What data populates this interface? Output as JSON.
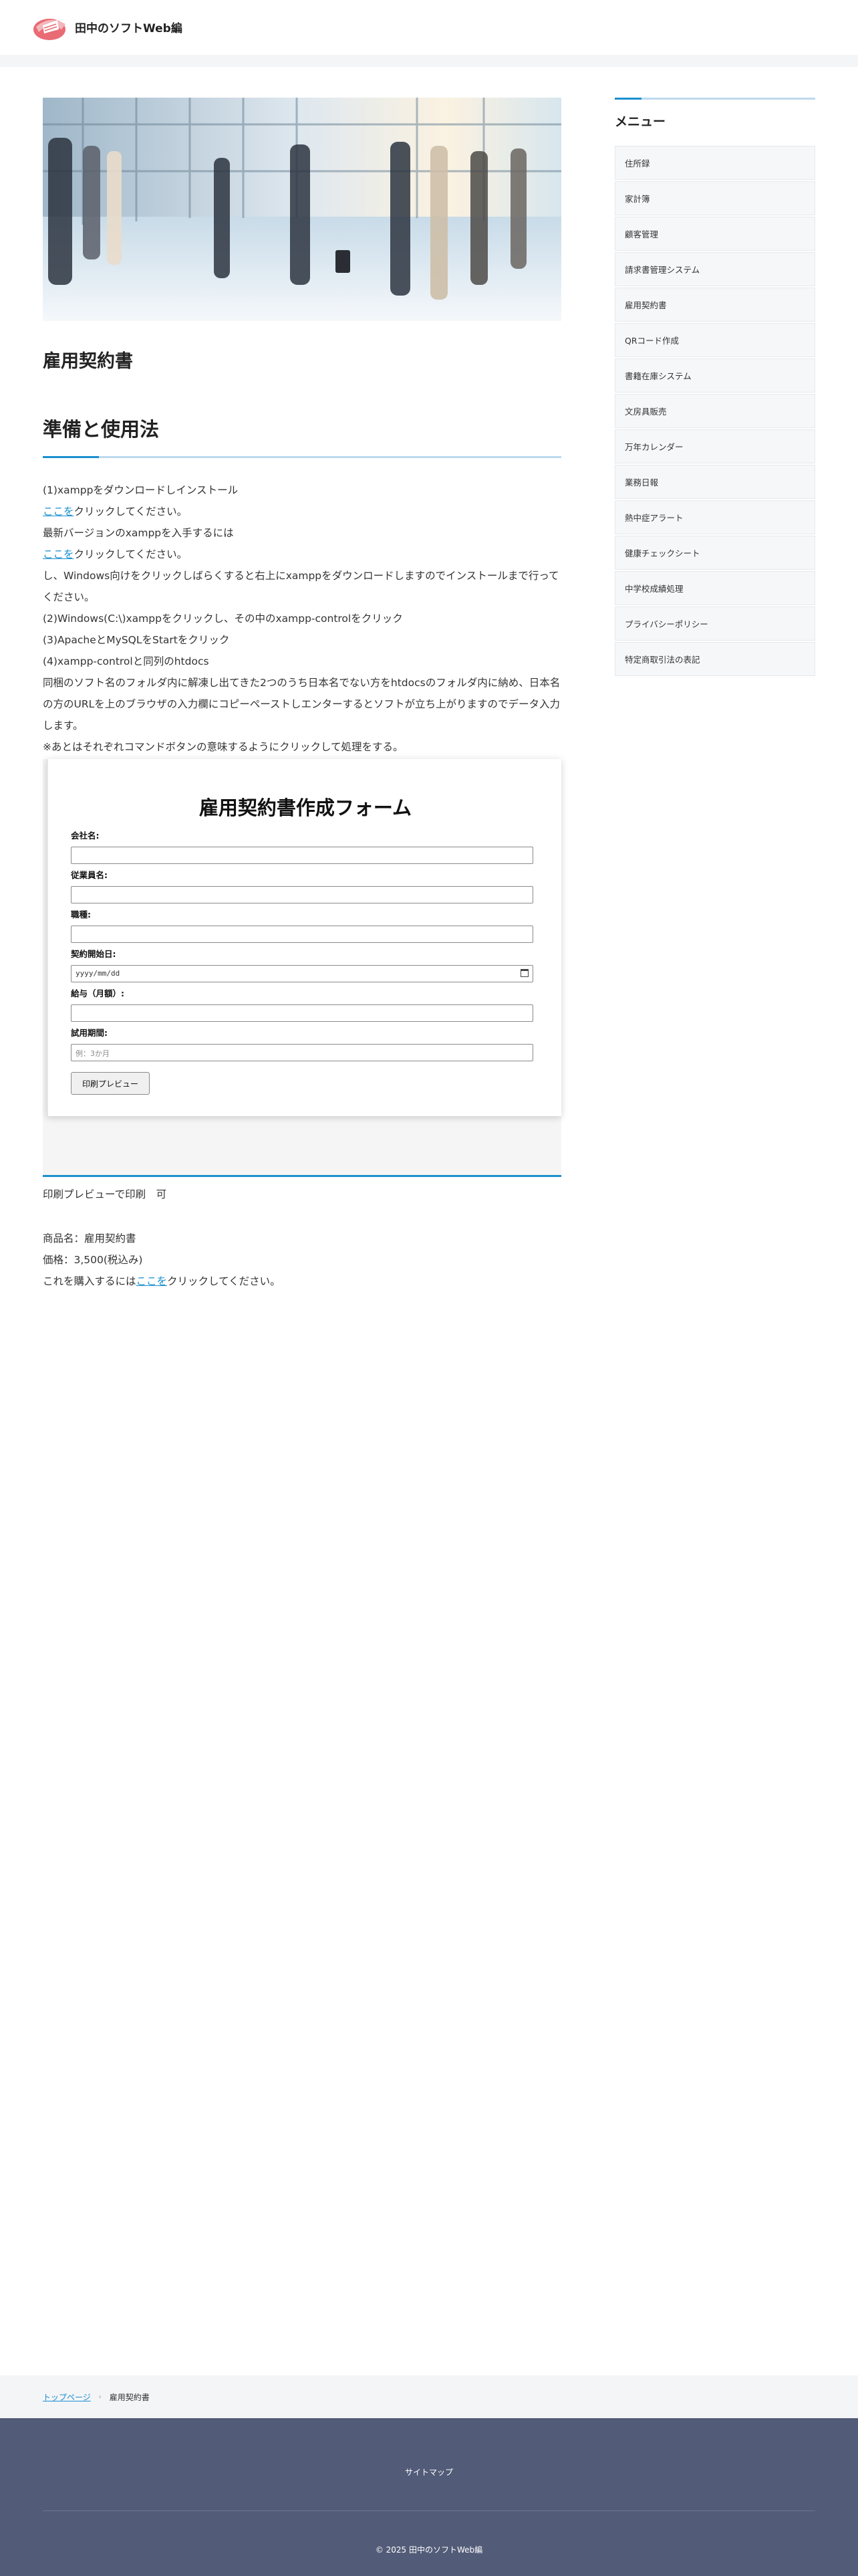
{
  "header": {
    "site_name": "田中のソフトWeb編"
  },
  "post": {
    "title": "雇用契約書"
  },
  "section": {
    "heading": "準備と使用法"
  },
  "instructions": [
    {
      "text": "(1)xamppをダウンロードしインストール"
    },
    {
      "link": "ここを",
      "text": "クリックしてください。"
    },
    {
      "text": "最新バージョンのxamppを入手するには"
    },
    {
      "link": "ここを",
      "text": "クリックしてください。"
    },
    {
      "text": "し、Windows向けをクリックしばらくすると右上にxamppをダウンロードしますのでインストールまで行ってください。"
    },
    {
      "text": "(2)Windows(C:\\)xamppをクリックし、その中のxampp-controlをクリック"
    },
    {
      "text": "(3)ApacheとMySQLをStartをクリック"
    },
    {
      "text": "(4)xampp-controlと同列のhtdocs"
    },
    {
      "text": "同梱のソフト名のフォルダ内に解凍し出てきた2つのうち日本名でない方をhtdocsのフォルダ内に納め、日本名の方のURLを上のブラウザの入力欄にコピーペーストしエンターするとソフトが立ち上がりますのでデータ入力します。"
    },
    {
      "text": "※あとはそれぞれコマンドボタンの意味するようにクリックして処理をする。"
    }
  ],
  "form": {
    "title": "雇用契約書作成フォーム",
    "company_label": "会社名:",
    "company_value": "",
    "employee_label": "従業員名:",
    "employee_value": "",
    "position_label": "職種:",
    "position_value": "",
    "start_label": "契約開始日:",
    "start_placeholder": "yyyy/mm/dd",
    "salary_label": "給与（月額）:",
    "salary_value": "",
    "trial_label": "試用期間:",
    "trial_placeholder": "例：3か月",
    "preview_button": "印刷プレビュー"
  },
  "after_text": "印刷プレビューで印刷　可",
  "product": {
    "name_line": "商品名：雇用契約書",
    "price_line": "価格：3,500(税込み)",
    "buy_prefix": "これを購入するには",
    "buy_link": "ここを",
    "buy_suffix": "クリックしてください。"
  },
  "sidebar": {
    "title": "メニュー",
    "items": [
      "住所録",
      "家計簿",
      "顧客管理",
      "請求書管理システム",
      "雇用契約書",
      "QRコード作成",
      "書籍在庫システム",
      "文房具販売",
      "万年カレンダー",
      "業務日報",
      "熱中症アラート",
      "健康チェックシート",
      "中学校成績処理",
      "プライバシーポリシー",
      "特定商取引法の表記"
    ]
  },
  "breadcrumb": {
    "home": "トップページ",
    "current": "雇用契約書"
  },
  "footer": {
    "sitemap": "サイトマップ",
    "copyright": "© 2025 田中のソフトWeb編"
  },
  "colors": {
    "accent": "#1a8fcf",
    "footer_bg": "#525c78"
  }
}
